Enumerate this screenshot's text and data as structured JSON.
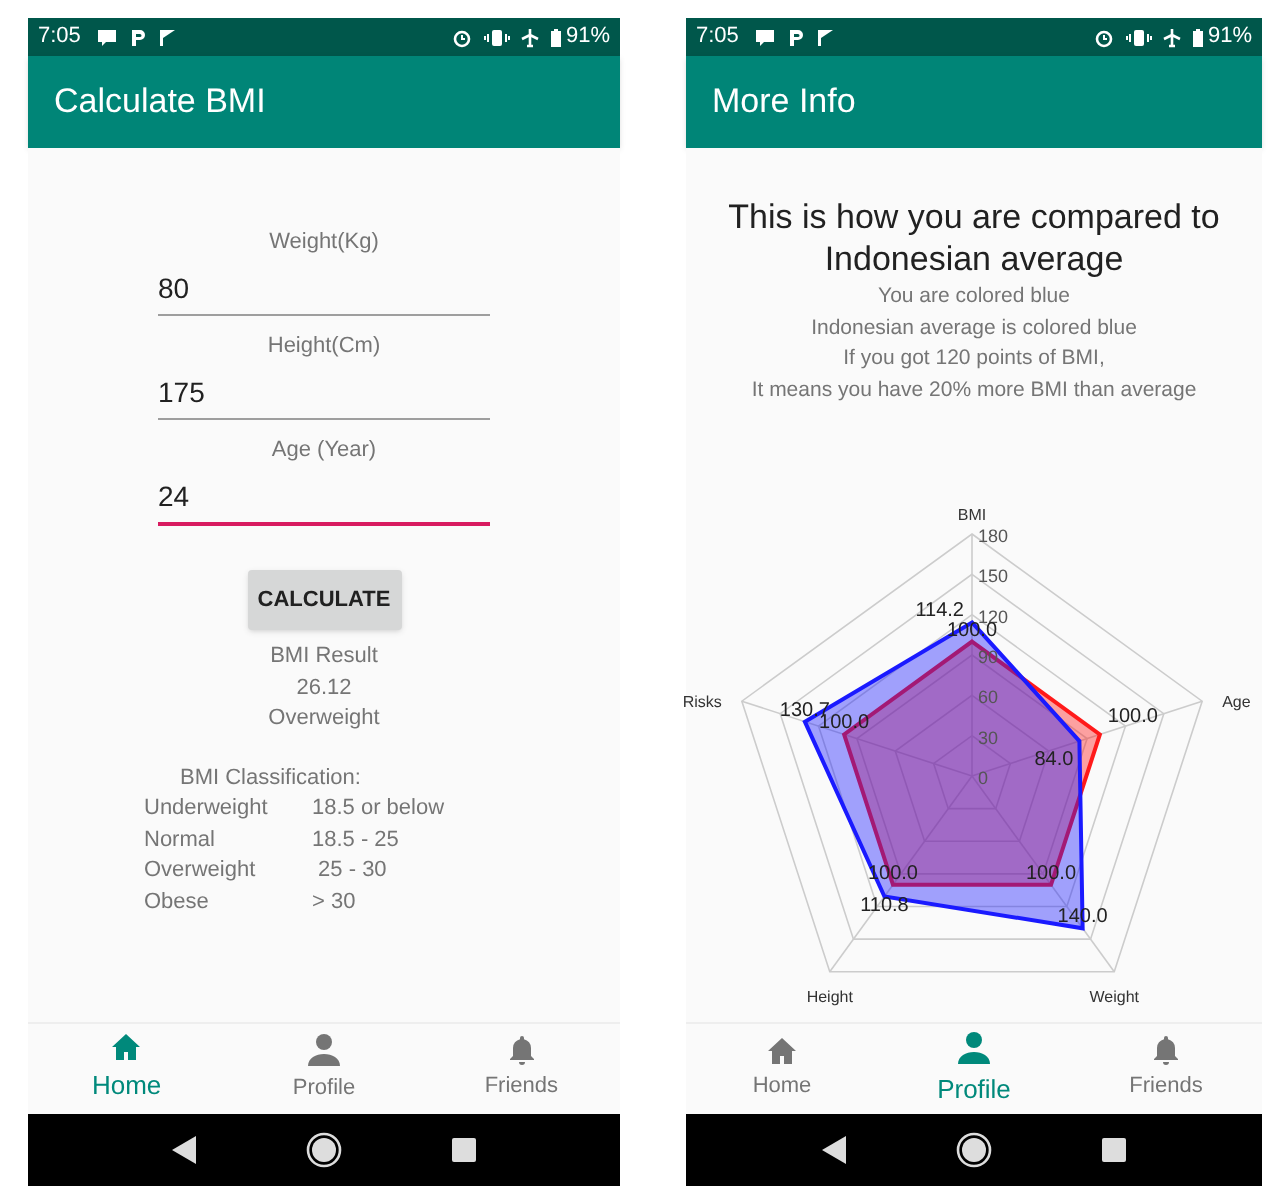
{
  "screens": [
    {
      "kind": "calculate",
      "status_bar": {
        "time": "7:05",
        "battery": "91%"
      },
      "app_bar": {
        "title": "Calculate BMI"
      },
      "fields": [
        {
          "label": "Weight(Kg)",
          "value": "80",
          "focused": false
        },
        {
          "label": "Height(Cm)",
          "value": "175",
          "focused": false
        },
        {
          "label": "Age (Year)",
          "value": "24",
          "focused": true
        }
      ],
      "button": "CALCULATE",
      "result": {
        "label": "BMI Result",
        "value": "26.12",
        "category": "Overweight"
      },
      "classification": {
        "title": "BMI Classification:",
        "rows": [
          [
            "Underweight",
            "18.5 or below"
          ],
          [
            "Normal",
            "18.5 - 25"
          ],
          [
            "Overweight",
            " 25 - 30"
          ],
          [
            "Obese",
            "> 30"
          ]
        ]
      },
      "nav": [
        {
          "label": "Home",
          "selected": true
        },
        {
          "label": "Profile",
          "selected": false
        },
        {
          "label": "Friends",
          "selected": false
        }
      ]
    },
    {
      "kind": "more_info",
      "status_bar": {
        "time": "7:05",
        "battery": "91%"
      },
      "app_bar": {
        "title": "More Info"
      },
      "heading": "This is how you are compared to Indonesian average",
      "notes": [
        "You are colored blue",
        "Indonesian average is colored blue",
        "If you got 120 points of BMI,",
        "It means you have 20% more BMI than average"
      ],
      "radar": {
        "axes": [
          "BMI",
          "Age",
          "Weight",
          "Height",
          "Risks"
        ],
        "ticks": [
          "180",
          "150",
          "120",
          "90",
          "60",
          "30",
          "0"
        ],
        "series": [
          {
            "color": "#ff1a1a",
            "labels": [
              "100.0",
              "100.0",
              "100.0",
              "100.0",
              "100.0"
            ]
          },
          {
            "color": "#1a1aff",
            "labels": [
              "114.2",
              "84.0",
              "140.0",
              "110.8",
              "130.7"
            ]
          }
        ]
      },
      "nav": [
        {
          "label": "Home",
          "selected": false
        },
        {
          "label": "Profile",
          "selected": true
        },
        {
          "label": "Friends",
          "selected": false
        }
      ]
    }
  ]
}
